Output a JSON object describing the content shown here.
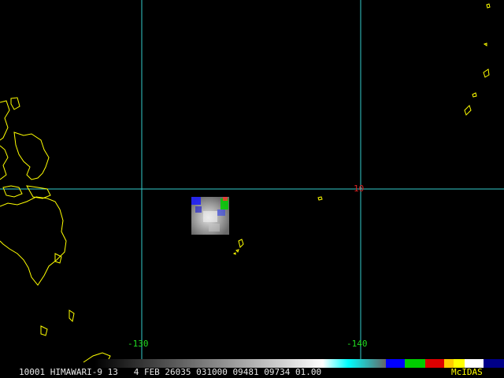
{
  "map": {
    "background": "#000000",
    "coastline_color": "#ffff00",
    "grid_color": "#33cccc",
    "longitude_labels": [
      "-130",
      "-140"
    ],
    "latitude_labels": [
      "10"
    ],
    "lon_label_color": "#22dd22",
    "lat_label_color": "#dd2222"
  },
  "satellite_patch": {
    "description_colors": [
      "#1a1aff",
      "#00cc00",
      "#cccccc",
      "#8a8a8a"
    ]
  },
  "footer": {
    "caption": "10001 HIMAWARI-9 13   4 FEB 26035 031000 09481 09734 01.00",
    "brand": "McIDAS"
  },
  "colorbar": {
    "stops": [
      "#000000",
      "#ffffff",
      "#00ffff",
      "#777777",
      "#0000ff",
      "#00cc00",
      "#ff0000",
      "#ffff00",
      "#ffffff",
      "#0000aa"
    ]
  }
}
